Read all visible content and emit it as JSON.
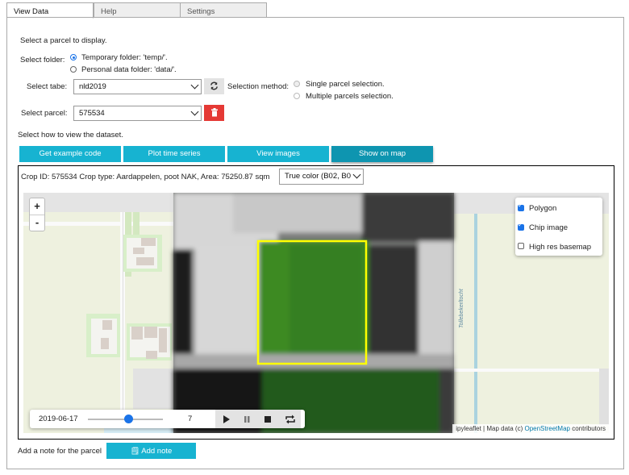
{
  "tabs": [
    {
      "label": "View Data"
    },
    {
      "label": "Help"
    },
    {
      "label": "Settings"
    }
  ],
  "intro": "Select a parcel to display.",
  "folder": {
    "label": "Select folder:",
    "options": [
      "Temporary folder: 'temp/'.",
      "Personal data folder: 'data/'."
    ],
    "selected": 0
  },
  "table": {
    "label": "Select tabe:",
    "value": "nld2019"
  },
  "selection_method": {
    "label": "Selection method:",
    "options": [
      "Single parcel selection.",
      "Multiple parcels selection."
    ]
  },
  "parcel": {
    "label": "Select parcel:",
    "value": "575534"
  },
  "view_label": "Select how to view the dataset.",
  "view_buttons": [
    "Get example code",
    "Plot time series",
    "View images",
    "Show on map"
  ],
  "crop_info": "Crop ID: 575534 Crop type: Aardappelen, poot NAK, Area: 75250.87 sqm",
  "band_select": "True color (B02, B0",
  "map": {
    "zoom_in": "+",
    "zoom_out": "-",
    "layers": [
      {
        "label": "Polygon",
        "checked": true
      },
      {
        "label": "Chip image",
        "checked": true
      },
      {
        "label": "High res basemap",
        "checked": false
      }
    ],
    "street": "Tollebekerltocht",
    "attribution_prefix": "ipyleaflet | Map data (c) ",
    "attribution_link": "OpenStreetMap",
    "attribution_suffix": " contributors",
    "player": {
      "date": "2019-06-17",
      "value": "7",
      "slider_fraction": 0.54
    }
  },
  "note": {
    "label": "Add a note for the parcel",
    "button": "Add note"
  },
  "colors": {
    "accent": "#17b3d1",
    "active": "#0e95b0",
    "danger": "#e53935",
    "polygon": "#ffff00"
  }
}
